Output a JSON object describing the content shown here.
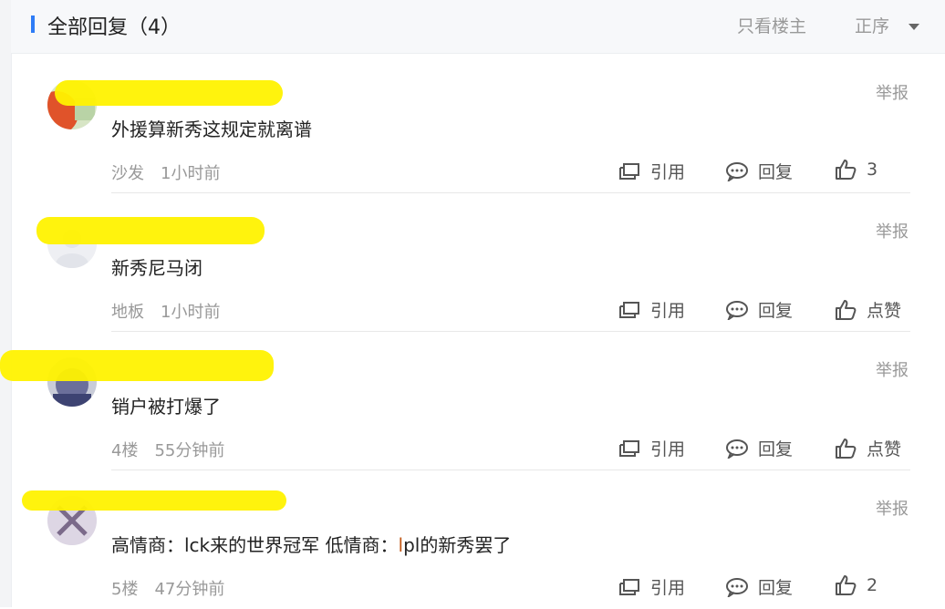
{
  "header": {
    "title": "全部回复（4）",
    "only_owner": "只看楼主",
    "order": "正序"
  },
  "actions": {
    "quote": "引用",
    "reply": "回复",
    "report": "举报"
  },
  "posts": [
    {
      "content": "外援算新秀这规定就离谱",
      "floor": "沙发",
      "time": "1小时前",
      "likes": "3"
    },
    {
      "content": "新秀尼马闭",
      "floor": "地板",
      "time": "1小时前",
      "likes": "点赞"
    },
    {
      "content": "销户被打爆了",
      "floor": "4楼",
      "time": "55分钟前",
      "likes": "点赞"
    },
    {
      "content_a": "高情商：lck来的世界冠军 低情商：",
      "content_b": "l",
      "content_c": "pl的新秀罢了",
      "floor": "5楼",
      "time": "47分钟前",
      "likes": "2"
    }
  ],
  "colors": {
    "accent": "#2e7cf6",
    "redaction": "#fff200"
  }
}
